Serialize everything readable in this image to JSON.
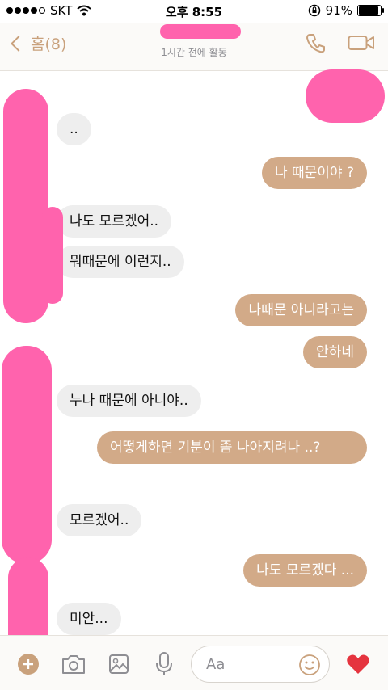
{
  "status": {
    "carrier": "SKT",
    "time": "오후 8:55",
    "battery_text": "91%",
    "battery_level": 0.91
  },
  "header": {
    "back_label": "홈(8)",
    "last_active": "1시간 전에 활동"
  },
  "messages": [
    {
      "side": "in",
      "text": ".."
    },
    {
      "side": "out",
      "text": "나 때문이야 ?"
    },
    {
      "side": "in",
      "text": "나도 모르겠어.."
    },
    {
      "side": "in",
      "text": "뭐때문에 이런지.."
    },
    {
      "side": "out",
      "text": "나때문 아니라고는"
    },
    {
      "side": "out",
      "text": "안하네"
    },
    {
      "side": "in",
      "text": "누나 때문에 아니야.."
    },
    {
      "side": "out",
      "text": "어떻게하면 기분이 좀  나아지려나 ..?"
    },
    {
      "side": "in",
      "text": "모르겠어.."
    },
    {
      "side": "out",
      "text": "나도 모르겠다 ..."
    },
    {
      "side": "in",
      "text": "미안..."
    }
  ],
  "composer": {
    "placeholder": "Aa"
  },
  "colors": {
    "accent": "#c9a17c",
    "outgoing_bubble": "#d2aa88",
    "incoming_bubble": "#eeeeee",
    "heart": "#e5343f"
  }
}
